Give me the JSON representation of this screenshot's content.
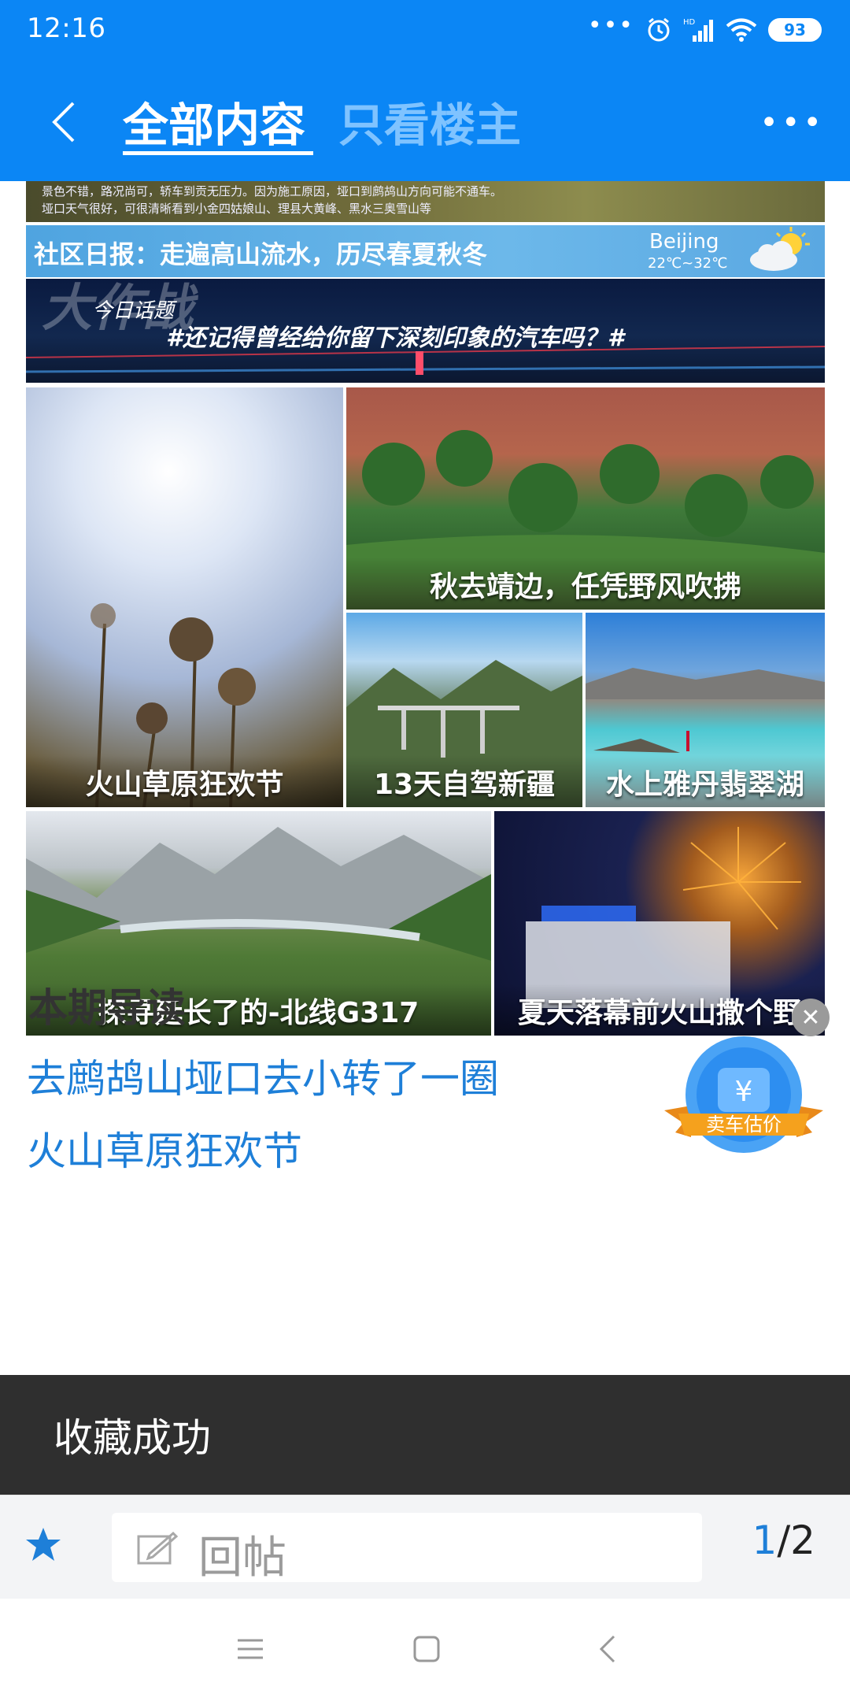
{
  "status_bar": {
    "time": "12:16",
    "battery": "93",
    "signal_label": "HD"
  },
  "nav": {
    "tab_all": "全部内容",
    "tab_op": "只看楼主"
  },
  "poster": {
    "top_text_line1": "景色不错，路况尚可，轿车到贡无压力。因为施工原因，垭口到鹧鸪山方向可能不通车。",
    "top_text_line2": "垭口天气很好，可很清晰看到小金四姑娘山、理县大黄峰、黑水三奥雪山等",
    "daily": "社区日报：走遍高山流水，历尽春夏秋冬",
    "city": "Beijing",
    "temperature": "22℃~32℃",
    "topic_big": "大作战",
    "topic_label": "今日话题",
    "topic_text": "#还记得曾经给你留下深刻印象的汽车吗？#"
  },
  "photos": [
    {
      "caption": "火山草原狂欢节"
    },
    {
      "caption": "秋去靖边，任凭野风吹拂"
    },
    {
      "caption": "13天自驾新疆"
    },
    {
      "caption": "水上雅丹翡翠湖"
    },
    {
      "caption": "探寻延长了的-北线G317"
    },
    {
      "caption": "夏天落幕前火山撒个野"
    }
  ],
  "guide": {
    "title": "本期导读",
    "links": [
      "去鹧鸪山垭口去小转了一圈",
      "火山草原狂欢节"
    ]
  },
  "promo": {
    "label": "卖车估价",
    "symbol": "¥"
  },
  "toast": "收藏成功",
  "toolbar": {
    "reply_placeholder": "回帖",
    "page_current": "1",
    "page_sep_total": "/2"
  },
  "colors": {
    "brand_blue": "#0b86f5",
    "link_blue": "#1e7fd8",
    "toast_bg": "#2f2f2f"
  }
}
